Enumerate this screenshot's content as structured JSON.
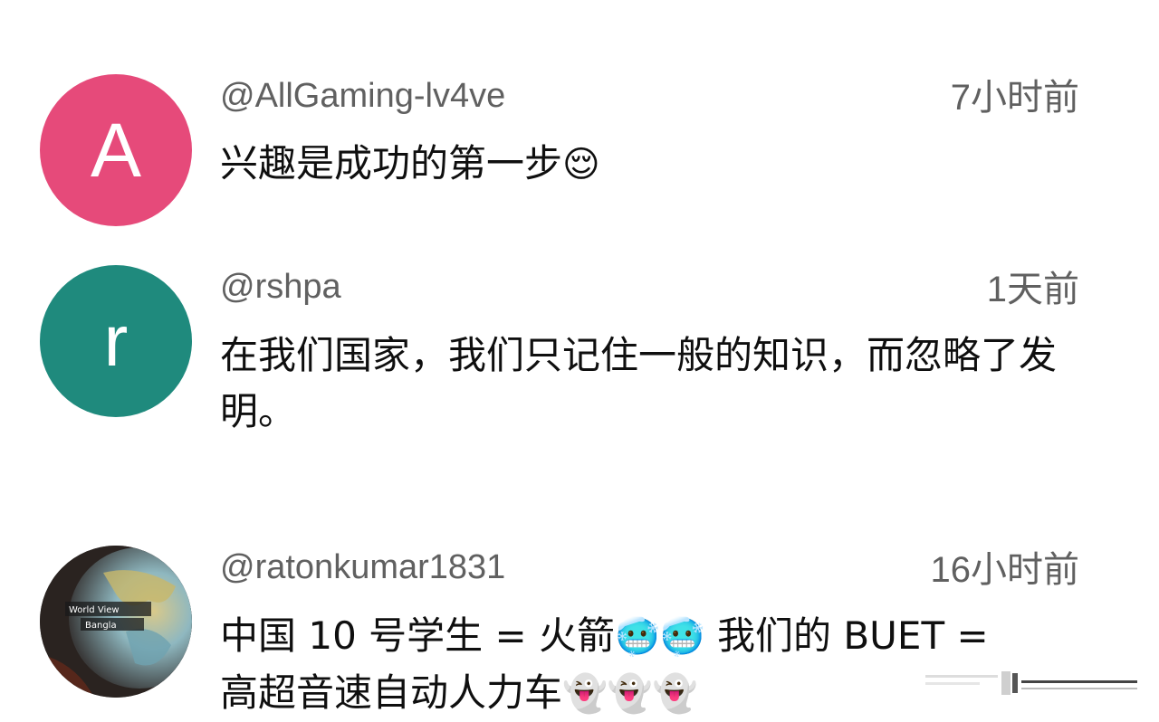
{
  "comments": [
    {
      "avatar_letter": "A",
      "avatar_color": "#e64a7a",
      "handle": "@AllGaming-lv4ve",
      "time": "7小时前",
      "text": "兴趣是成功的第一步",
      "emoji": "😌"
    },
    {
      "avatar_letter": "r",
      "avatar_color": "#1f8a7d",
      "handle": "@rshpa",
      "time": "1天前",
      "text": "在我们国家，我们只记住一般的知识，而忽略了发明。",
      "emoji": ""
    },
    {
      "avatar_letter": "",
      "avatar_image": "globe-photo",
      "avatar_label_lines": [
        "World View",
        "Bangla"
      ],
      "handle": "@ratonkumar1831",
      "time": "16小时前",
      "text_line1": "中国 10 号学生 = 火箭",
      "emoji_line1": "🥶🥶",
      "text_line1_b": " 我们的 BUET =",
      "text_line2": "高超音速自动人力车",
      "emoji_line2": "👻👻👻"
    }
  ]
}
